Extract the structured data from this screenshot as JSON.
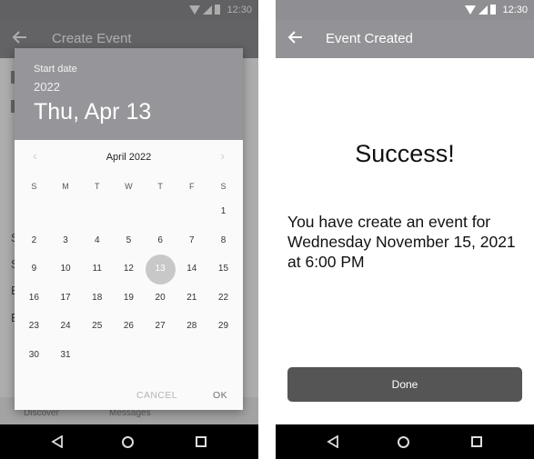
{
  "status_bar": {
    "time": "12:30"
  },
  "left_screen": {
    "appbar_title": "Create Event",
    "background_tabs": [
      "Discover",
      "Messages"
    ],
    "background_letters": [
      "S",
      "S",
      "E",
      "E"
    ],
    "date_picker": {
      "label": "Start date",
      "year": "2022",
      "selected_date": "Thu, Apr 13",
      "month_title": "April 2022",
      "weekdays": [
        "S",
        "M",
        "T",
        "W",
        "T",
        "F",
        "S"
      ],
      "weeks": [
        [
          "",
          "",
          "",
          "",
          "",
          "",
          "1"
        ],
        [
          "2",
          "3",
          "4",
          "5",
          "6",
          "7",
          "8"
        ],
        [
          "9",
          "10",
          "11",
          "12",
          "13",
          "14",
          "15"
        ],
        [
          "16",
          "17",
          "18",
          "19",
          "20",
          "21",
          "22"
        ],
        [
          "23",
          "24",
          "25",
          "26",
          "27",
          "28",
          "29"
        ],
        [
          "30",
          "31",
          "",
          "",
          "",
          "",
          ""
        ]
      ],
      "selected_day": "13",
      "cancel_label": "CANCEL",
      "ok_label": "OK"
    }
  },
  "right_screen": {
    "appbar_title": "Event Created",
    "heading": "Success!",
    "message": "You have create an event for Wednesday November 15, 2021 at 6:00 PM",
    "done_label": "Done"
  }
}
